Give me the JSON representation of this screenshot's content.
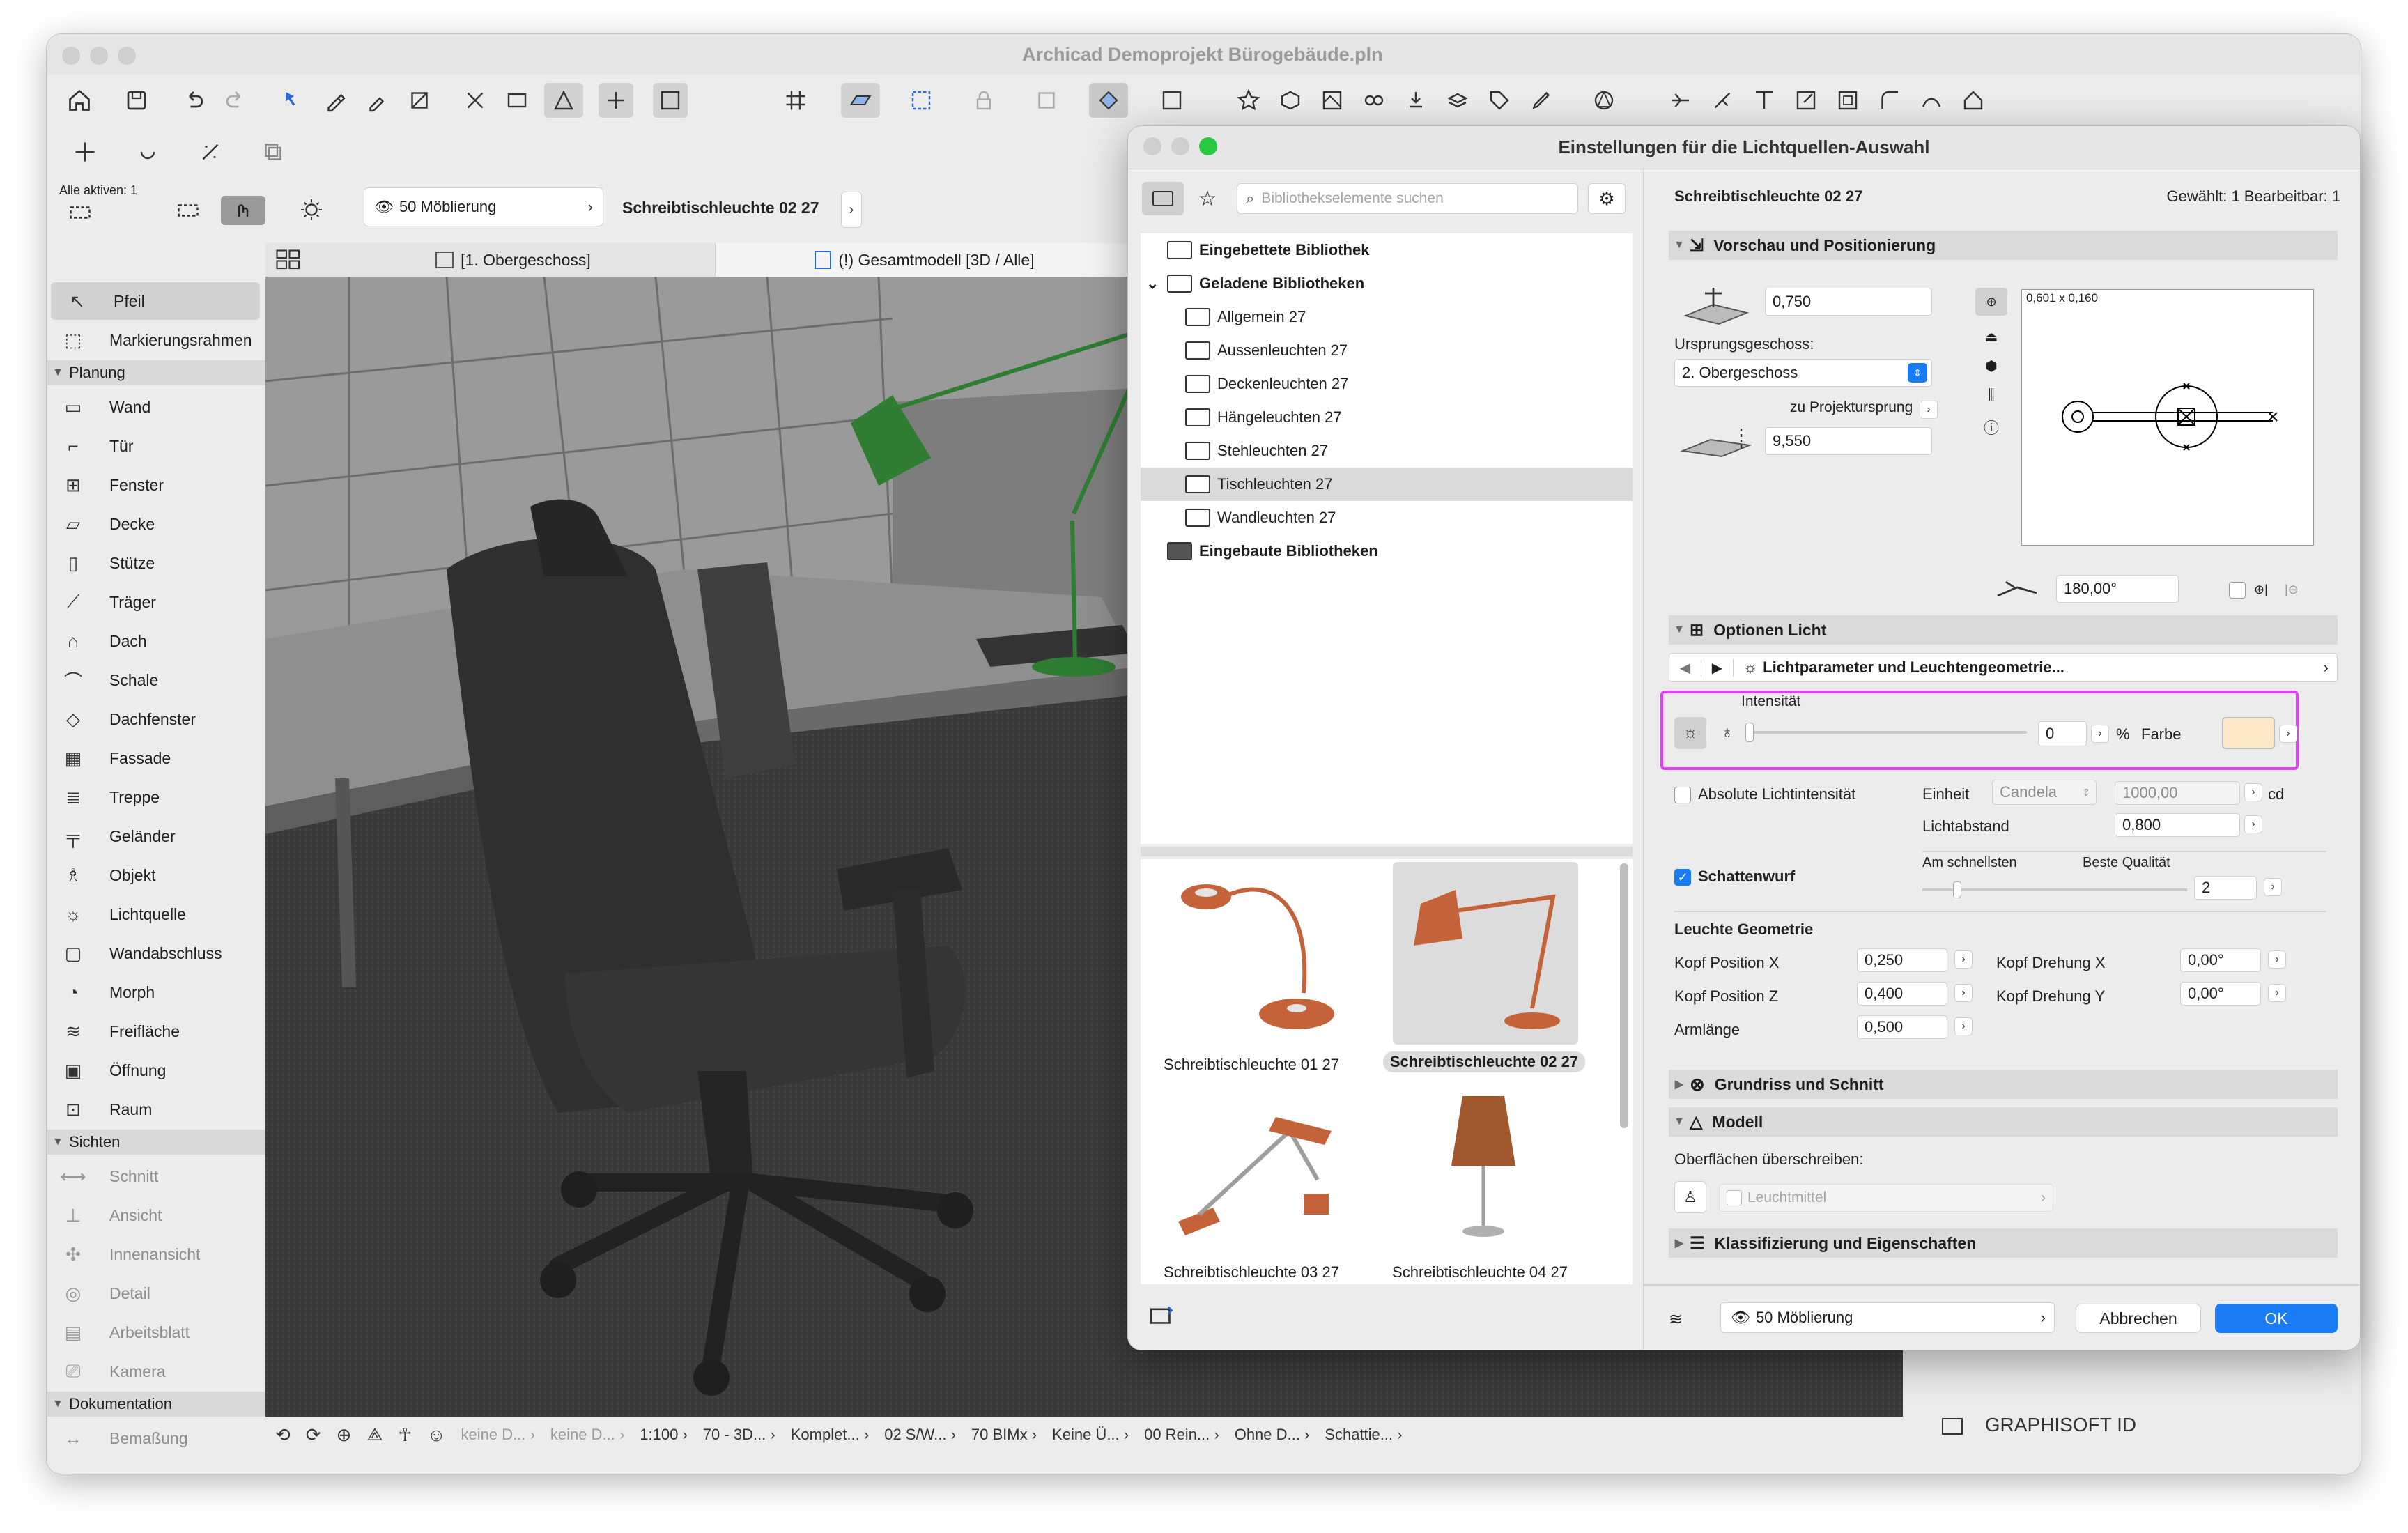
{
  "app": {
    "title": "Archicad Demoprojekt Bürogebäude.pln",
    "active_label": "Alle aktiven: 1",
    "layer_combo": "50 Möblierung",
    "element_name": "Schreibtischleuchte 02 27"
  },
  "toolbox": {
    "tools_top": [
      {
        "label": "Pfeil",
        "icon": "arrow-icon"
      },
      {
        "label": "Markierungsrahmen",
        "icon": "marquee-icon"
      }
    ],
    "sections": {
      "planung": "Planung",
      "sichten": "Sichten",
      "dokumentation": "Dokumentation"
    },
    "planung_items": [
      {
        "label": "Wand",
        "icon": "wall-icon"
      },
      {
        "label": "Tür",
        "icon": "door-icon"
      },
      {
        "label": "Fenster",
        "icon": "window-icon"
      },
      {
        "label": "Decke",
        "icon": "slab-icon"
      },
      {
        "label": "Stütze",
        "icon": "column-icon"
      },
      {
        "label": "Träger",
        "icon": "beam-icon"
      },
      {
        "label": "Dach",
        "icon": "roof-icon"
      },
      {
        "label": "Schale",
        "icon": "shell-icon"
      },
      {
        "label": "Dachfenster",
        "icon": "skylight-icon"
      },
      {
        "label": "Fassade",
        "icon": "curtain-wall-icon"
      },
      {
        "label": "Treppe",
        "icon": "stair-icon"
      },
      {
        "label": "Geländer",
        "icon": "railing-icon"
      },
      {
        "label": "Objekt",
        "icon": "object-icon"
      },
      {
        "label": "Lichtquelle",
        "icon": "lamp-icon"
      },
      {
        "label": "Wandabschluss",
        "icon": "wall-end-icon"
      },
      {
        "label": "Morph",
        "icon": "morph-icon"
      },
      {
        "label": "Freifläche",
        "icon": "mesh-icon"
      },
      {
        "label": "Öffnung",
        "icon": "opening-icon"
      },
      {
        "label": "Raum",
        "icon": "zone-icon"
      }
    ],
    "sichten_items": [
      {
        "label": "Schnitt",
        "icon": "section-icon"
      },
      {
        "label": "Ansicht",
        "icon": "elevation-icon"
      },
      {
        "label": "Innenansicht",
        "icon": "interior-elevation-icon"
      },
      {
        "label": "Detail",
        "icon": "detail-icon"
      },
      {
        "label": "Arbeitsblatt",
        "icon": "worksheet-icon"
      },
      {
        "label": "Kamera",
        "icon": "camera-icon"
      }
    ],
    "doku_items": [
      {
        "label": "Bemaßung",
        "icon": "dimension-icon"
      }
    ]
  },
  "tabs": {
    "floor_plan": "[1. Obergeschoss]",
    "model_3d": "(!) Gesamtmodell [3D / Alle]"
  },
  "statusbar": [
    "keine D...",
    "keine D...",
    "1:100",
    "70 - 3D...",
    "Komplet...",
    "02 S/W...",
    "70 BIMx",
    "Keine Ü...",
    "00 Rein...",
    "Ohne D...",
    "Schattie..."
  ],
  "brand": "GRAPHISOFT ID",
  "dialog": {
    "title": "Einstellungen für die Lichtquellen-Auswahl",
    "search_placeholder": "Bibliothekselemente suchen",
    "tree": [
      {
        "label": "Eingebettete Bibliothek",
        "level": 0,
        "bold": true
      },
      {
        "label": "Geladene Bibliotheken",
        "level": 0,
        "bold": true
      },
      {
        "label": "Allgemein 27",
        "level": 1
      },
      {
        "label": "Aussenleuchten 27",
        "level": 1
      },
      {
        "label": "Deckenleuchten 27",
        "level": 1
      },
      {
        "label": "Hängeleuchten 27",
        "level": 1
      },
      {
        "label": "Stehleuchten 27",
        "level": 1
      },
      {
        "label": "Tischleuchten 27",
        "level": 1,
        "selected": true
      },
      {
        "label": "Wandleuchten 27",
        "level": 1
      },
      {
        "label": "Eingebaute Bibliotheken",
        "level": 0,
        "bold": true
      }
    ],
    "thumbnails": [
      {
        "label": "Schreibtischleuchte 01 27",
        "selected": false
      },
      {
        "label": "Schreibtischleuchte 02 27",
        "selected": true
      },
      {
        "label": "Schreibtischleuchte 03 27",
        "selected": false
      },
      {
        "label": "Schreibtischleuchte 04 27",
        "selected": false
      }
    ],
    "header_name": "Schreibtischleuchte 02 27",
    "selection_info": "Gewählt: 1 Bearbeitbar: 1",
    "preview": {
      "title": "Vorschau und Positionierung",
      "elevation": "0,750",
      "origin_story_label": "Ursprungsgeschoss:",
      "origin_story": "2. Obergeschoss",
      "project_origin_label": "zu Projektursprung",
      "project_origin_value": "9,550",
      "size_label": "0,601 x 0,160",
      "rotation": "180,00°"
    },
    "light": {
      "title": "Optionen Licht",
      "subpage": "Lichtparameter und Leuchtengeometrie...",
      "intensity_label": "Intensität",
      "intensity_value": "0",
      "intensity_unit": "%",
      "color_label": "Farbe",
      "light_color": "#fde8c8",
      "absolute_label": "Absolute Lichtintensität",
      "unit_label": "Einheit",
      "unit_value": "Candela",
      "candela_value": "1000,00",
      "candela_unit": "cd",
      "distance_label": "Lichtabstand",
      "distance_value": "0,800",
      "shadow_label": "Schattenwurf",
      "fast_label": "Am schnellsten",
      "quality_label": "Beste Qualität",
      "quality_value": "2"
    },
    "geometry": {
      "title": "Leuchte Geometrie",
      "rows": [
        {
          "label": "Kopf Position X",
          "value": "0,250",
          "label2": "Kopf Drehung X",
          "value2": "0,00°"
        },
        {
          "label": "Kopf Position Z",
          "value": "0,400",
          "label2": "Kopf Drehung Y",
          "value2": "0,00°"
        },
        {
          "label": "Armlänge",
          "value": "0,500"
        }
      ]
    },
    "sections": {
      "floorplan": "Grundriss und Schnitt",
      "model": "Modell",
      "override_label": "Oberflächen überschreiben:",
      "material": "Leuchtmittel",
      "classification": "Klassifizierung und Eigenschaften"
    },
    "footer": {
      "layer": "50 Möblierung",
      "cancel": "Abbrechen",
      "ok": "OK"
    }
  },
  "colors": {
    "accent": "#1a7cf5",
    "highlight": "#e040fb",
    "lamp": "#c4623a"
  }
}
